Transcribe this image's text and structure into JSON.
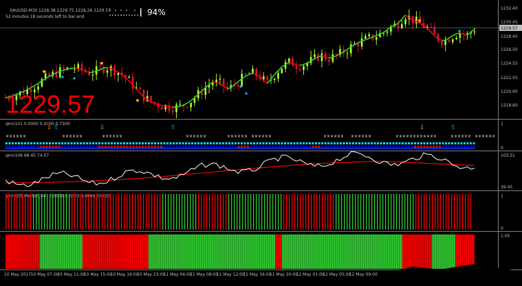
{
  "header": {
    "symbol_line": "XAUUSD,M30  1228.38 1229.75 1228.26 1229.57",
    "timer_text": "52 minutes 18 seconds left to bar end",
    "progress_percent": "94%",
    "progress_fraction": 0.94
  },
  "big_price": "1229.57",
  "main_axis": {
    "ticks": [
      "1232.40",
      "1230.45",
      "1228.45",
      "1226.50",
      "1224.55",
      "1222.55",
      "1220.60",
      "1218.60"
    ],
    "current_price_label": "1229.57"
  },
  "indicator1": {
    "title": "qmn101 0.0000 0.4700 0.7300",
    "axis_top": "1",
    "axis_bottom": "0"
  },
  "indicator2": {
    "title": "qmn106 68.45 74.57",
    "axis_top": "103.51",
    "axis_bottom": "39.45"
  },
  "indicator3": {
    "title": "qmn005 (Period_H4) 0.0000 0.0000 1.0000 0.0000",
    "axis_top": "1",
    "axis_bottom": "0"
  },
  "indicator4": {
    "axis_top": "1.05"
  },
  "time_axis": [
    "10 May 2017",
    "10 May 07:00",
    "10 May 11:00",
    "10 May 15:00",
    "10 May 19:00",
    "10 May 23:00",
    "11 May 04:00",
    "11 May 08:00",
    "11 May 12:00",
    "11 May 16:00",
    "11 May 20:00",
    "12 May 01:00",
    "12 May 05:00",
    "12 May 09:00"
  ],
  "colors": {
    "background": "#000000",
    "bull_candle": "#adff2f",
    "bear_candle": "#dc143c",
    "ma_up": "#32cd32",
    "ma_down": "#ff0000",
    "big_price": "#ff0000",
    "cyan_marker": "#00bfff",
    "orange_marker": "#ffa500",
    "histogram_green": "#32cd32",
    "histogram_red": "#ff0000",
    "grid_line": "#808080"
  },
  "chart_data": {
    "type": "candlestick",
    "close_path": [
      1220.2,
      1220.5,
      1220.9,
      1221.4,
      1222.0,
      1222.7,
      1223.3,
      1223.8,
      1224.1,
      1224.3,
      1224.0,
      1223.6,
      1223.9,
      1224.4,
      1224.1,
      1223.5,
      1222.6,
      1221.4,
      1220.3,
      1219.6,
      1219.2,
      1219.0,
      1218.9,
      1219.1,
      1219.7,
      1220.6,
      1221.6,
      1222.4,
      1222.1,
      1221.3,
      1222.2,
      1223.0,
      1223.6,
      1223.2,
      1222.1,
      1223.4,
      1224.5,
      1225.1,
      1224.6,
      1224.8,
      1225.4,
      1226.0,
      1225.6,
      1225.9,
      1226.5,
      1227.2,
      1227.8,
      1228.2,
      1228.6,
      1229.0,
      1229.8,
      1230.3,
      1231.5,
      1230.8,
      1230.3,
      1229.6,
      1228.4,
      1227.9,
      1228.6,
      1229.1,
      1228.7,
      1229.6
    ],
    "signal_line_value": 1229.57
  }
}
